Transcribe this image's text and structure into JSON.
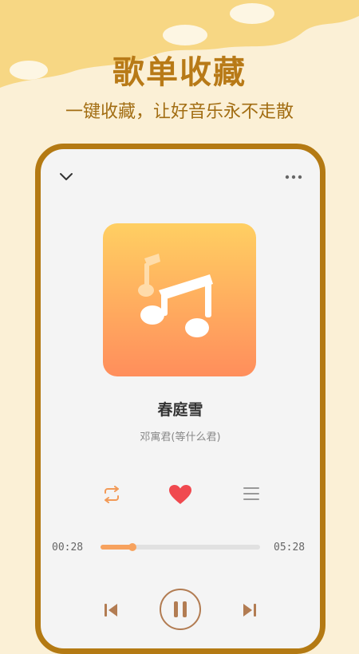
{
  "header": {
    "title": "歌单收藏",
    "subtitle": "一键收藏，让好音乐永不走散"
  },
  "player": {
    "song_title": "春庭雪",
    "artist": "邓寓君(等什么君)",
    "current_time": "00:28",
    "total_time": "05:28",
    "progress": 0.092,
    "favorited": true
  },
  "icons": {
    "collapse": "chevron-down-icon",
    "more": "more-dots-icon",
    "cover": "music-note-icon",
    "repeat": "repeat-icon",
    "favorite": "heart-icon",
    "playlist": "playlist-icon",
    "previous": "previous-icon",
    "pause": "pause-icon",
    "next": "next-icon"
  },
  "colors": {
    "accent": "#b87a17",
    "heart": "#f0494f",
    "progress": "#f7a25e",
    "cover_top": "#ffcf62",
    "cover_bottom": "#ff8e5c"
  }
}
